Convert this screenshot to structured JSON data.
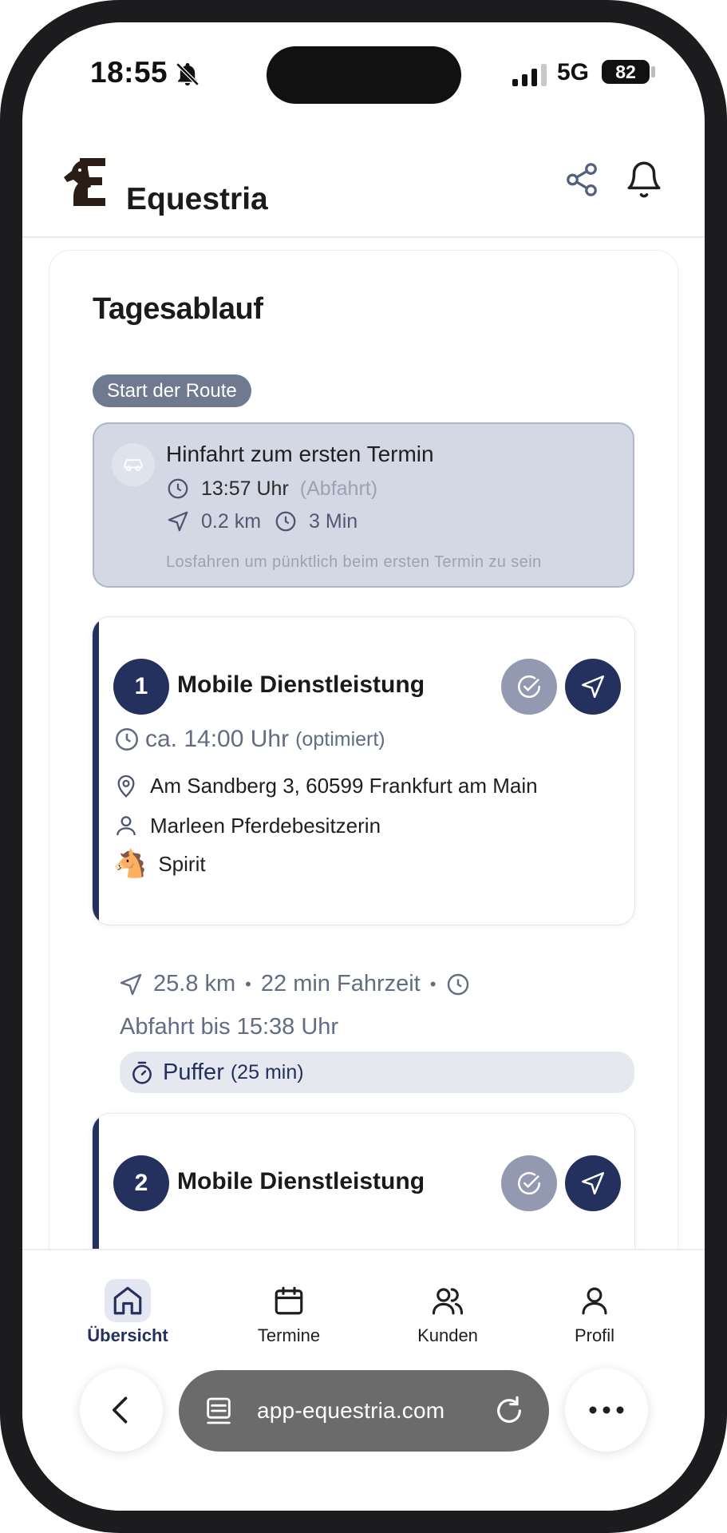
{
  "status_bar": {
    "time": "18:55",
    "network": "5G",
    "battery": "82"
  },
  "header": {
    "title": "Equestria"
  },
  "section": {
    "title": "Tagesablauf"
  },
  "route_start": {
    "pill": "Start der Route",
    "title": "Hinfahrt zum ersten Termin",
    "departure_time": "13:57 Uhr",
    "departure_note": "(Abfahrt)",
    "distance": "0.2 km",
    "duration": "3 Min",
    "hint": "Losfahren um pünktlich beim ersten Termin zu sein"
  },
  "appointments": [
    {
      "number": "1",
      "title": "Mobile Dienstleistung",
      "time": "ca. 14:00 Uhr",
      "time_note": "(optimiert)",
      "address": "Am Sandberg 3, 60599 Frankfurt am Main",
      "customer": "Marleen Pferdebesitzerin",
      "horse": "Spirit"
    },
    {
      "number": "2",
      "title": "Mobile Dienstleistung"
    }
  ],
  "travel": {
    "distance": "25.8 km",
    "duration": "22 min Fahrzeit",
    "separator": "•",
    "departure": "Abfahrt bis 15:38 Uhr",
    "buffer_label": "Puffer",
    "buffer_note": "(25 min)"
  },
  "bottom_nav": [
    {
      "label": "Übersicht",
      "icon": "home-icon",
      "active": true
    },
    {
      "label": "Termine",
      "icon": "calendar-icon",
      "active": false
    },
    {
      "label": "Kunden",
      "icon": "users-icon",
      "active": false
    },
    {
      "label": "Profil",
      "icon": "user-icon",
      "active": false
    }
  ],
  "browser": {
    "url": "app-equestria.com"
  },
  "colors": {
    "primary": "#24305e",
    "muted": "#626c83",
    "route_bg": "#d3d8e4",
    "pill": "#6f7a91"
  }
}
